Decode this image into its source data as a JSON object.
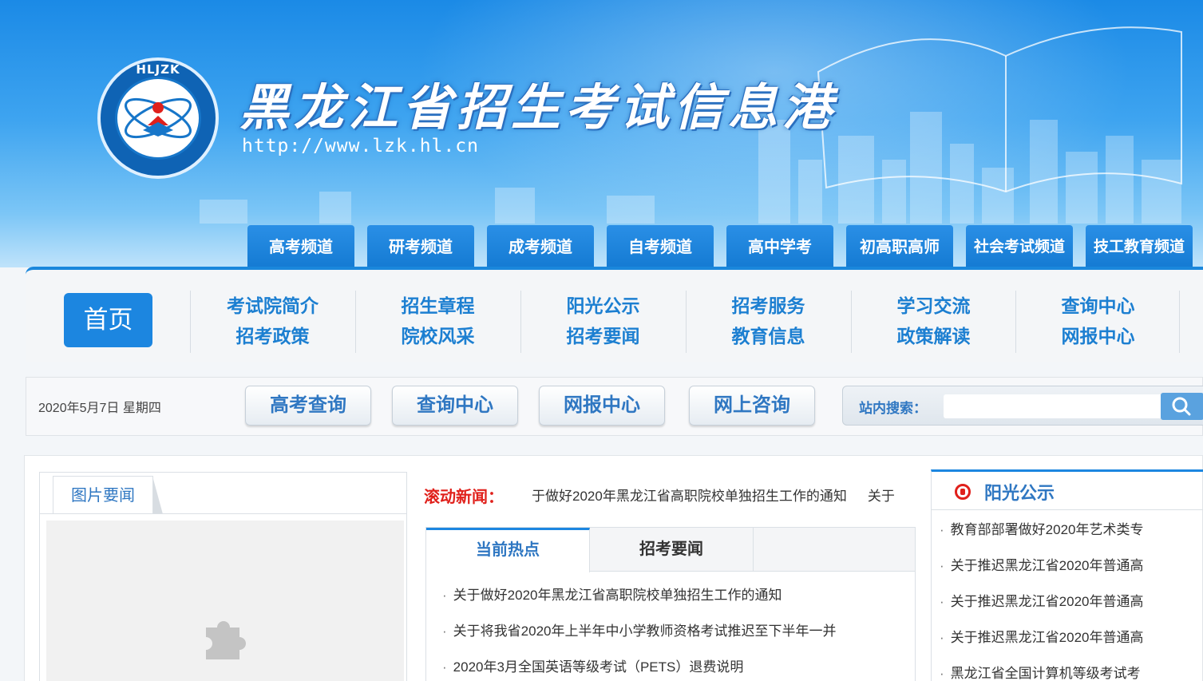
{
  "header": {
    "logo_text": "HLJZK",
    "logo_ring_text": "黑龙江招生考试信息港",
    "site_title": "黑龙江省招生考试信息港",
    "site_url": "http://www.lzk.hl.cn"
  },
  "channels": [
    "高考频道",
    "研考频道",
    "成考频道",
    "自考频道",
    "高中学考",
    "初高职高师",
    "社会考试频道",
    "技工教育频道"
  ],
  "nav": {
    "home": "首页",
    "columns": [
      {
        "top": "考试院简介",
        "bottom": "招考政策"
      },
      {
        "top": "招生章程",
        "bottom": "院校风采"
      },
      {
        "top": "阳光公示",
        "bottom": "招考要闻"
      },
      {
        "top": "招考服务",
        "bottom": "教育信息"
      },
      {
        "top": "学习交流",
        "bottom": "政策解读"
      },
      {
        "top": "查询中心",
        "bottom": "网报中心"
      }
    ]
  },
  "quickbar": {
    "date": "2020年5月7日 星期四",
    "buttons": [
      "高考查询",
      "查询中心",
      "网报中心",
      "网上咨询"
    ],
    "search_label": "站内搜索：",
    "search_placeholder": ""
  },
  "picture_news": {
    "tab": "图片要闻"
  },
  "scrolling": {
    "label": "滚动新闻：",
    "items": [
      "于做好2020年黑龙江省高职院校单独招生工作的通知",
      "关于"
    ]
  },
  "news": {
    "tabs": [
      "当前热点",
      "招考要闻"
    ],
    "items": [
      "关于做好2020年黑龙江省高职院校单独招生工作的通知",
      "关于将我省2020年上半年中小学教师资格考试推迟至下半年一并",
      "2020年3月全国英语等级考试（PETS）退费说明"
    ]
  },
  "sunshine": {
    "title": "阳光公示",
    "items": [
      "教育部部署做好2020年艺术类专",
      "关于推迟黑龙江省2020年普通高",
      "关于推迟黑龙江省2020年普通高",
      "关于推迟黑龙江省2020年普通高",
      "黑龙江省全国计算机等级考试考"
    ]
  },
  "colors": {
    "brand_blue": "#1c86e0",
    "link_blue": "#2f77c2",
    "scroll_red": "#e0201b"
  },
  "icons": {
    "search": "magnifier",
    "puzzle": "puzzle-piece",
    "sunshine": "red-circle-badge"
  }
}
